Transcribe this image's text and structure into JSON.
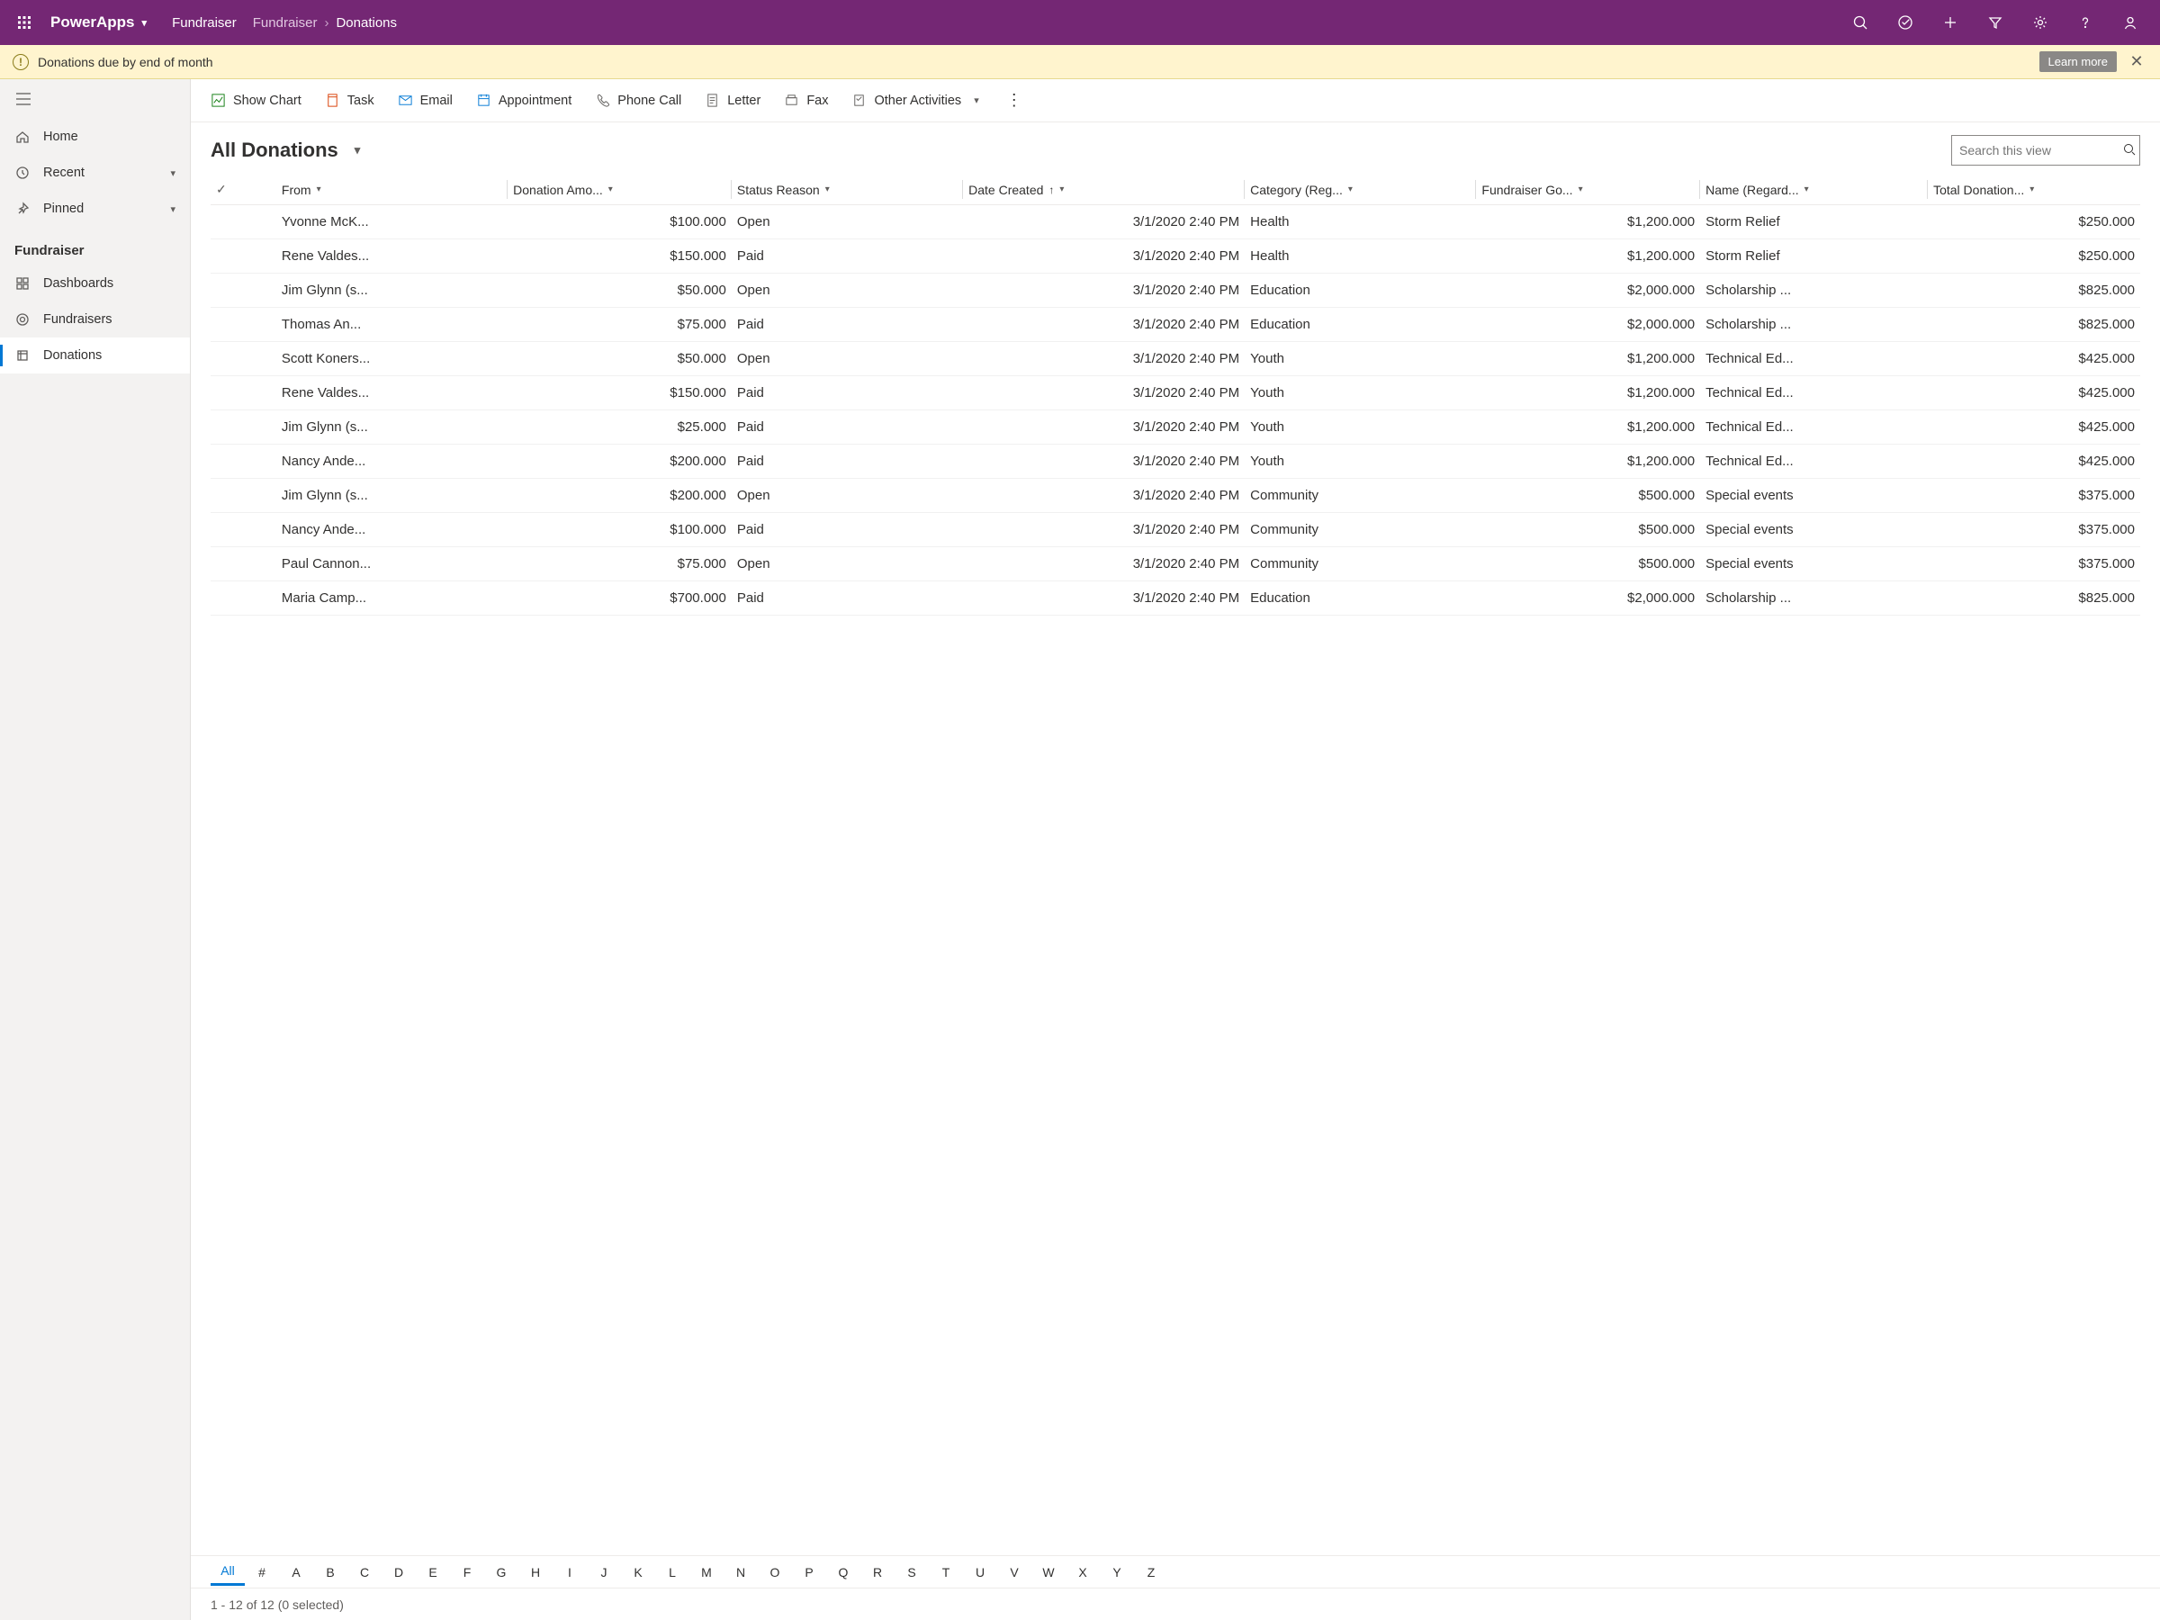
{
  "header": {
    "app_name": "PowerApps",
    "tab_name": "Fundraiser",
    "breadcrumb1": "Fundraiser",
    "breadcrumb2": "Donations"
  },
  "notification": {
    "text": "Donations due by end of month",
    "learn_more": "Learn more"
  },
  "sidebar": {
    "home": "Home",
    "recent": "Recent",
    "pinned": "Pinned",
    "section": "Fundraiser",
    "dashboards": "Dashboards",
    "fundraisers": "Fundraisers",
    "donations": "Donations"
  },
  "toolbar": {
    "show_chart": "Show Chart",
    "task": "Task",
    "email": "Email",
    "appointment": "Appointment",
    "phone_call": "Phone Call",
    "letter": "Letter",
    "fax": "Fax",
    "other": "Other Activities"
  },
  "view": {
    "title": "All Donations",
    "search_placeholder": "Search this view"
  },
  "columns": {
    "from": "From",
    "amount": "Donation Amo...",
    "status": "Status Reason",
    "date": "Date Created",
    "category": "Category (Reg...",
    "goal": "Fundraiser Go...",
    "name": "Name (Regard...",
    "total": "Total Donation..."
  },
  "rows": [
    {
      "from": "Yvonne McK...",
      "amount": "$100.000",
      "status": "Open",
      "date": "3/1/2020 2:40 PM",
      "category": "Health",
      "goal": "$1,200.000",
      "name": "Storm Relief",
      "total": "$250.000"
    },
    {
      "from": "Rene Valdes...",
      "amount": "$150.000",
      "status": "Paid",
      "date": "3/1/2020 2:40 PM",
      "category": "Health",
      "goal": "$1,200.000",
      "name": "Storm Relief",
      "total": "$250.000"
    },
    {
      "from": "Jim Glynn (s...",
      "amount": "$50.000",
      "status": "Open",
      "date": "3/1/2020 2:40 PM",
      "category": "Education",
      "goal": "$2,000.000",
      "name": "Scholarship ...",
      "total": "$825.000"
    },
    {
      "from": "Thomas An...",
      "amount": "$75.000",
      "status": "Paid",
      "date": "3/1/2020 2:40 PM",
      "category": "Education",
      "goal": "$2,000.000",
      "name": "Scholarship ...",
      "total": "$825.000"
    },
    {
      "from": "Scott Koners...",
      "amount": "$50.000",
      "status": "Open",
      "date": "3/1/2020 2:40 PM",
      "category": "Youth",
      "goal": "$1,200.000",
      "name": "Technical Ed...",
      "total": "$425.000"
    },
    {
      "from": "Rene Valdes...",
      "amount": "$150.000",
      "status": "Paid",
      "date": "3/1/2020 2:40 PM",
      "category": "Youth",
      "goal": "$1,200.000",
      "name": "Technical Ed...",
      "total": "$425.000"
    },
    {
      "from": "Jim Glynn (s...",
      "amount": "$25.000",
      "status": "Paid",
      "date": "3/1/2020 2:40 PM",
      "category": "Youth",
      "goal": "$1,200.000",
      "name": "Technical Ed...",
      "total": "$425.000"
    },
    {
      "from": "Nancy Ande...",
      "amount": "$200.000",
      "status": "Paid",
      "date": "3/1/2020 2:40 PM",
      "category": "Youth",
      "goal": "$1,200.000",
      "name": "Technical Ed...",
      "total": "$425.000"
    },
    {
      "from": "Jim Glynn (s...",
      "amount": "$200.000",
      "status": "Open",
      "date": "3/1/2020 2:40 PM",
      "category": "Community",
      "goal": "$500.000",
      "name": "Special events",
      "total": "$375.000"
    },
    {
      "from": "Nancy Ande...",
      "amount": "$100.000",
      "status": "Paid",
      "date": "3/1/2020 2:40 PM",
      "category": "Community",
      "goal": "$500.000",
      "name": "Special events",
      "total": "$375.000"
    },
    {
      "from": "Paul Cannon...",
      "amount": "$75.000",
      "status": "Open",
      "date": "3/1/2020 2:40 PM",
      "category": "Community",
      "goal": "$500.000",
      "name": "Special events",
      "total": "$375.000"
    },
    {
      "from": "Maria Camp...",
      "amount": "$700.000",
      "status": "Paid",
      "date": "3/1/2020 2:40 PM",
      "category": "Education",
      "goal": "$2,000.000",
      "name": "Scholarship ...",
      "total": "$825.000"
    }
  ],
  "alpha": [
    "All",
    "#",
    "A",
    "B",
    "C",
    "D",
    "E",
    "F",
    "G",
    "H",
    "I",
    "J",
    "K",
    "L",
    "M",
    "N",
    "O",
    "P",
    "Q",
    "R",
    "S",
    "T",
    "U",
    "V",
    "W",
    "X",
    "Y",
    "Z"
  ],
  "footer": {
    "status": "1 - 12 of 12 (0 selected)"
  }
}
